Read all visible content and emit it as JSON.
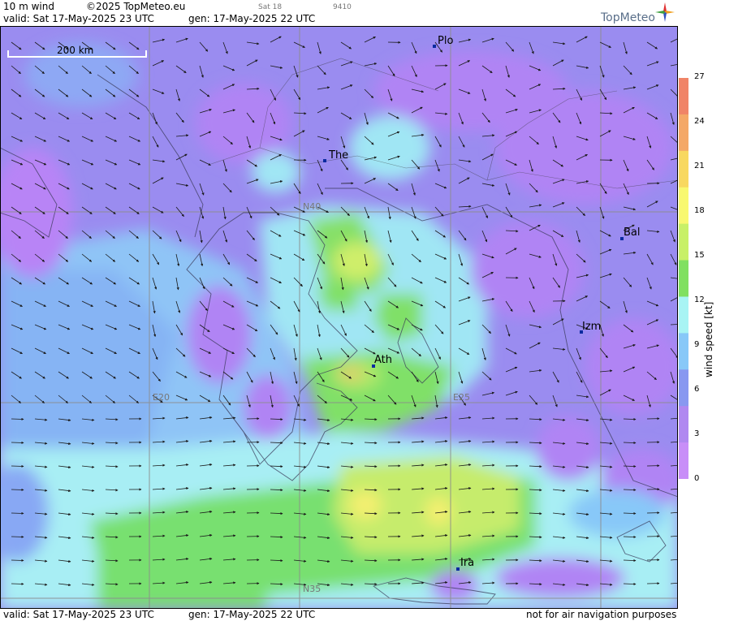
{
  "header": {
    "parameter": "10 m wind",
    "copyright": "©2025 TopMeteo.eu",
    "valid": "valid:  Sat  17-May-2025  23 UTC",
    "generated": "gen: 17-May-2025 22 UTC",
    "next_day": "Sat 18",
    "code": "9410",
    "logo": "TopMeteo"
  },
  "footer": {
    "valid": "valid:  Sat  17-May-2025  23 UTC",
    "generated": "gen: 17-May-2025 22 UTC",
    "disclaimer": "not for air navigation purposes"
  },
  "scale_bar": "200 km",
  "grid_labels": {
    "lat40": "N40",
    "lat35": "N35",
    "lon20": "E20",
    "lon25": "E25"
  },
  "cities": [
    {
      "name": "Plo"
    },
    {
      "name": "The"
    },
    {
      "name": "Bal"
    },
    {
      "name": "Izm"
    },
    {
      "name": "Ath"
    },
    {
      "name": "Ira"
    }
  ],
  "colorbar": {
    "title": "wind  speed  [kt]",
    "ticks": [
      "27",
      "24",
      "21",
      "18",
      "15",
      "12",
      "9",
      "6",
      "3",
      "0"
    ],
    "colors": [
      "#f08468",
      "#f4a868",
      "#f8d860",
      "#f8f870",
      "#c8f068",
      "#80e060",
      "#a8f4f4",
      "#88c8f8",
      "#8898f0",
      "#b088f0",
      "#c88ef8"
    ]
  },
  "colors": {
    "land_bg": "#9a8cf0",
    "sea_bg": "#8fd0f4",
    "calm": "#b08af4",
    "light": "#a8eef4",
    "moderate": "#78e070",
    "fresh": "#cfee6a",
    "strong": "#f0a070"
  }
}
